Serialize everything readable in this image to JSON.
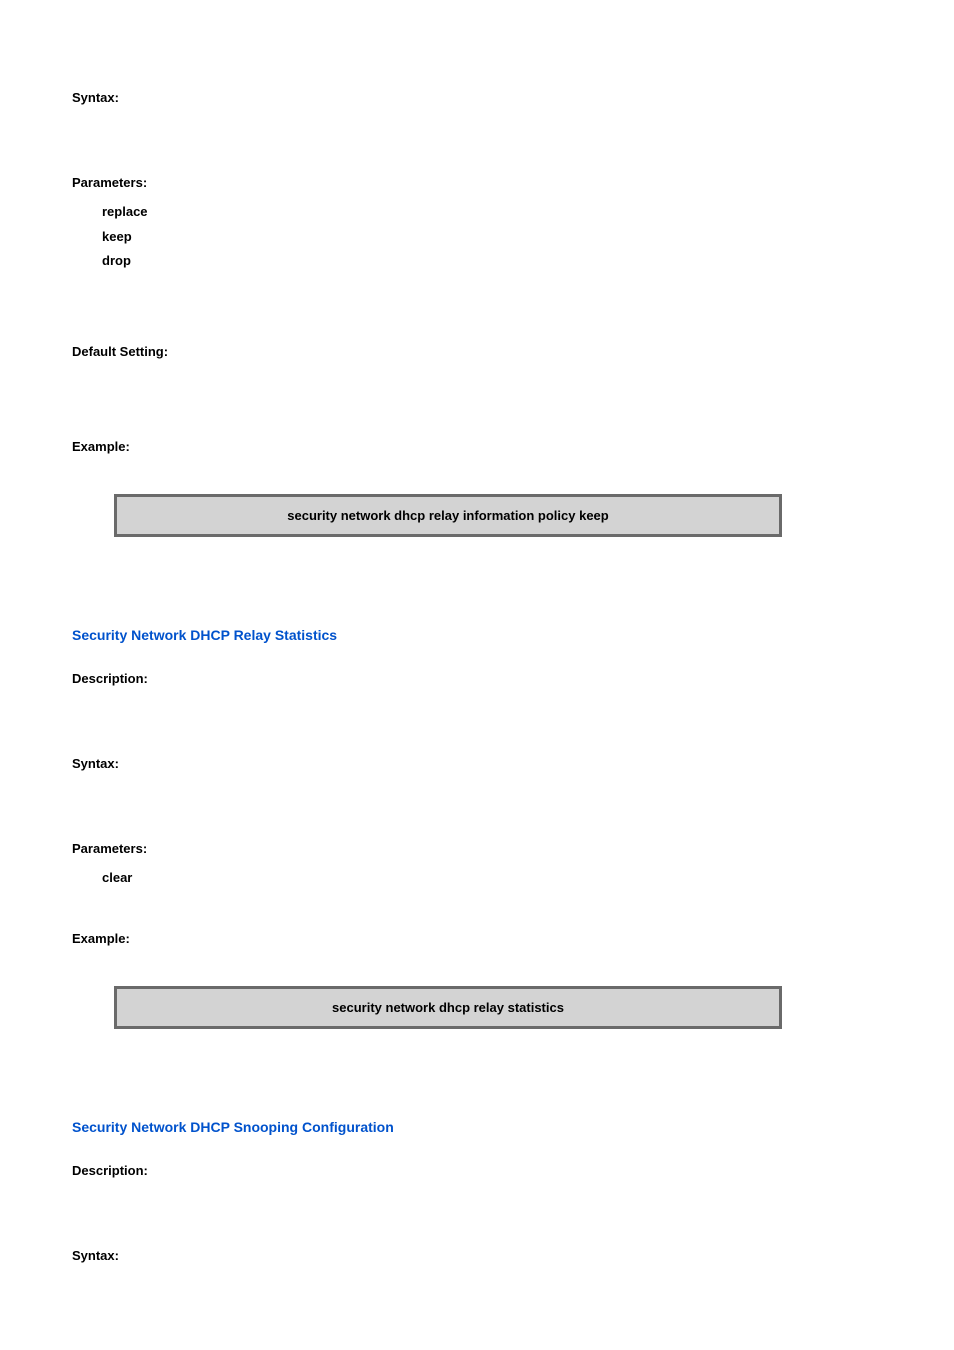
{
  "labels": {
    "syntax": "Syntax:",
    "parameters": "Parameters:",
    "default_setting": "Default Setting:",
    "example": "Example:",
    "description": "Description:"
  },
  "section1": {
    "params": [
      "replace",
      "keep",
      "drop"
    ],
    "code": "security network dhcp relay information policy keep"
  },
  "section2": {
    "heading": "Security Network DHCP Relay Statistics",
    "params": [
      "clear"
    ],
    "code": "security network dhcp relay statistics"
  },
  "section3": {
    "heading": "Security Network DHCP Snooping Configuration"
  }
}
